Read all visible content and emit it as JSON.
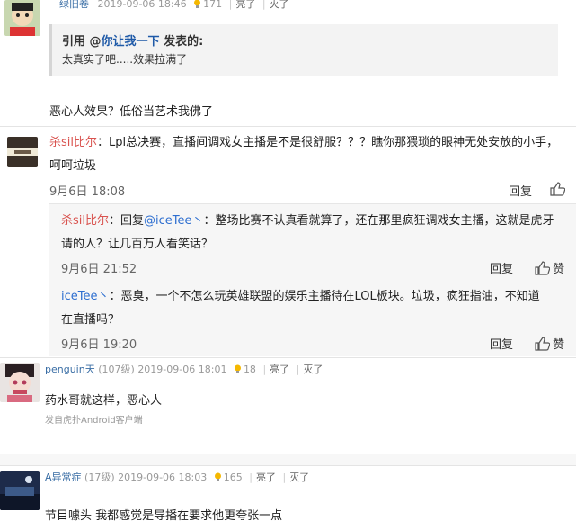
{
  "top_comment": {
    "username": "绿旧卷",
    "date": "2019-09-06 18:46",
    "light_count": "171",
    "light_label": "亮了",
    "hide_label": "灭了",
    "quote": {
      "prefix": "引用 @",
      "quoted_user": "你让我一下",
      "suffix": " 发表的:",
      "text": "太真实了吧.....效果拉满了"
    },
    "body": "恶心人效果？低俗当艺术我佛了"
  },
  "weibo_comment": {
    "username": "杀sil比尔",
    "sep": "：",
    "text_line1": "Lpl总决赛，直播间调戏女主播是不是很舒服？？？瞧你那猥琐的眼神无处安放的小手，",
    "text_line2": "呵呵垃圾",
    "date": "9月6日 18:08",
    "reply_label": "回复",
    "like_label": "赞",
    "replies": [
      {
        "username": "杀sil比尔",
        "sep": "：回复",
        "mention": "@iceTee丶",
        "text_after_mention": "：整场比赛不认真看就算了，还在那里疯狂调戏女主播，这就是虎牙",
        "text_line2": "请的人？让几百万人看笑话？",
        "date": "9月6日 21:52",
        "reply_label": "回复",
        "like_label": "赞"
      },
      {
        "username": "iceTee丶",
        "sep": "：恶臭，一个不怎么玩英雄联盟的娱乐主播待在LOL板块。垃圾，疯狂指油，不知道",
        "text_line2": "在直播吗？",
        "date": "9月6日 19:20",
        "reply_label": "回复",
        "like_label": "赞"
      }
    ]
  },
  "comment_penguin": {
    "username": "penguin天",
    "level": "(107级)",
    "date": "2019-09-06 18:01",
    "light_count": "18",
    "light_label": "亮了",
    "hide_label": "灭了",
    "body": "药水哥就这样，恶心人",
    "source": "发自虎扑Android客户端"
  },
  "comment_a": {
    "username": "A异常症",
    "level": "(17级)",
    "date": "2019-09-06 18:03",
    "light_count": "165",
    "light_label": "亮了",
    "hide_label": "灭了",
    "body": "节目噱头 我都感觉是导播在要求他更夸张一点"
  },
  "colors": {
    "username_blue": "#3a6ea5",
    "weibo_red": "#d9534f",
    "mention_blue": "#2e6fd0"
  }
}
